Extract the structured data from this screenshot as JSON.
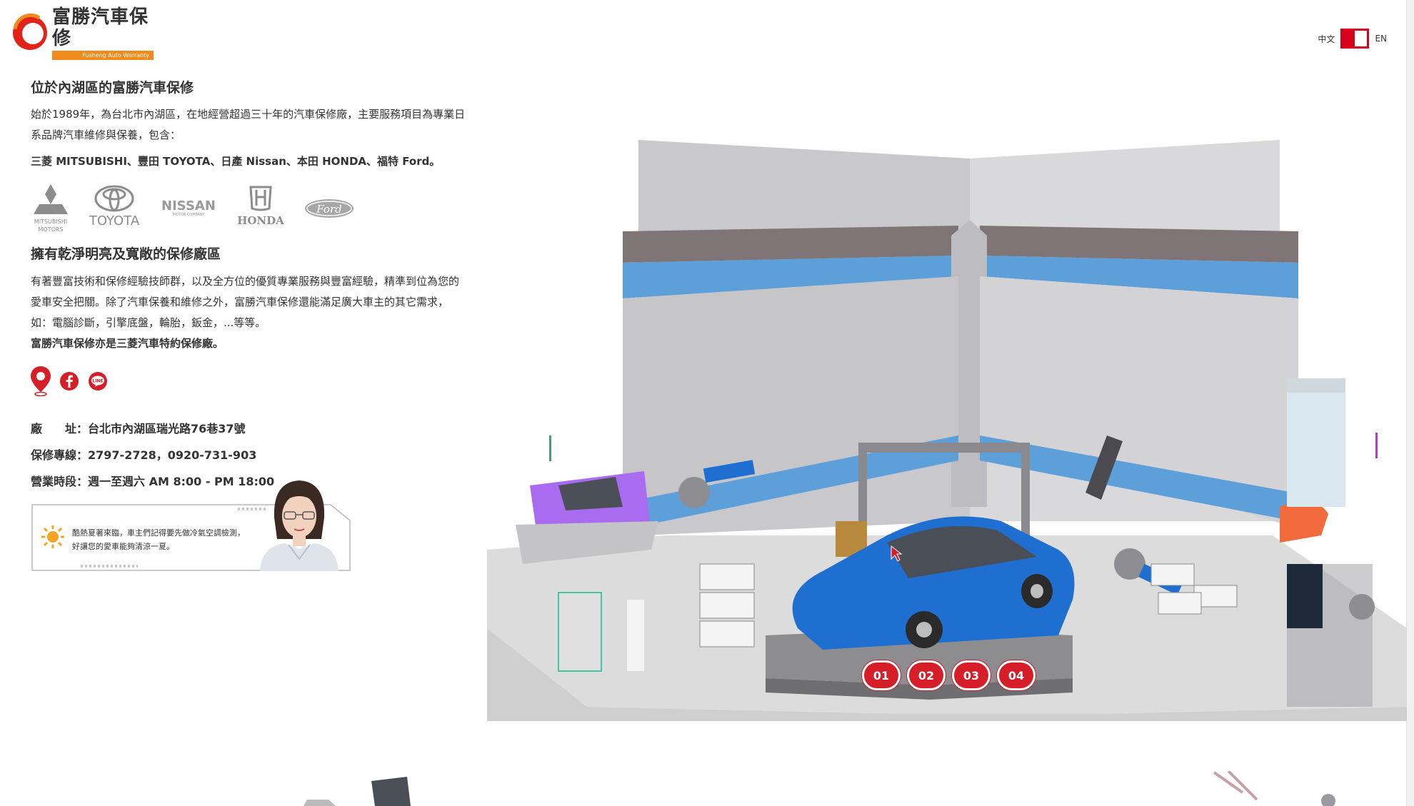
{
  "header": {
    "brand_name": "富勝汽車保修",
    "brand_sub": "Fusheng Auto Warranty",
    "lang_zh": "中文",
    "lang_en": "EN"
  },
  "intro": {
    "title": "位於內湖區的富勝汽車保修",
    "body": "始於1989年，為台北市內湖區，在地經營超過三十年的汽車保修廠，主要服務項目為專業日系品牌汽車維修與保養，包含：",
    "brands_line": "三菱 MITSUBISHI、豐田 TOYOTA、日產 Nissan、本田 HONDA、福特 Ford。"
  },
  "brand_logos": [
    {
      "name": "MITSUBISHI MOTORS",
      "icon": "mitsubishi-logo"
    },
    {
      "name": "TOYOTA",
      "icon": "toyota-logo"
    },
    {
      "name": "NISSAN",
      "icon": "nissan-logo"
    },
    {
      "name": "HONDA",
      "icon": "honda-logo"
    },
    {
      "name": "Ford",
      "icon": "ford-logo"
    }
  ],
  "facility": {
    "title": "擁有乾淨明亮及寬敞的保修廠區",
    "body": "有著豐富技術和保修經驗技師群，以及全方位的優質專業服務與豐富經驗，精準到位為您的愛車安全把關。除了汽車保養和維修之外，富勝汽車保修還能滿足廣大車主的其它需求，如：電腦診斷，引擎底盤，輪胎，鈑金，...等等。",
    "note": "富勝汽車保修亦是三菱汽車特約保修廠。"
  },
  "social": [
    {
      "name": "map-pin-icon"
    },
    {
      "name": "facebook-icon"
    },
    {
      "name": "line-icon"
    }
  ],
  "contact": {
    "address_label": "廠　　址：",
    "address": "台北市內湖區瑞光路76巷37號",
    "phone_label": "保修專線：",
    "phone": "2797-2728，0920-731-903",
    "hours_label": "營業時段：",
    "hours": "週一至週六 AM 8:00 - PM 18:00"
  },
  "notice": {
    "text": "酷熱夏著來臨，車主們記得要先做冷氣空調檢測，好讓您的愛車能夠清涼一夏。"
  },
  "steps": [
    "01",
    "02",
    "03",
    "04"
  ],
  "colors": {
    "accent_red": "#d61e28",
    "logo_orange": "#f08a1c",
    "car_blue": "#1f6fd1",
    "wall_stripe": "#5a9bd5"
  }
}
